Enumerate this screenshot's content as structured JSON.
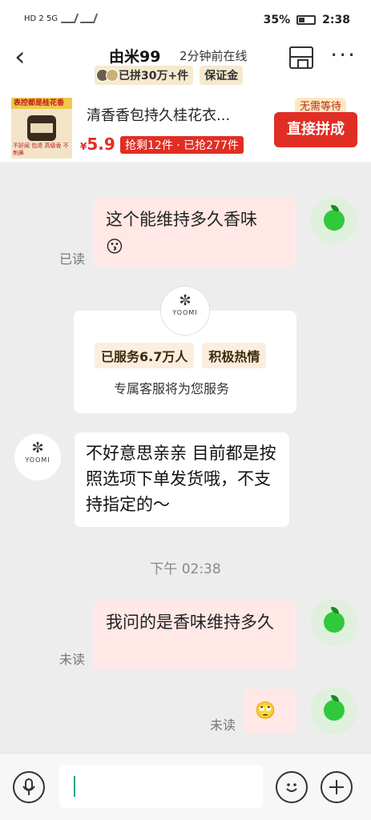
{
  "status_bar": {
    "network": "HD 2 5G",
    "battery": "35%",
    "time": "2:38"
  },
  "header": {
    "back_icon": "‹",
    "title": "由米99",
    "online": "2分钟前在线",
    "pin_tag": "已拼30万+件",
    "guarantee_tag": "保证金",
    "more_icon": "···"
  },
  "product": {
    "image_banner": "表控都是桂花香",
    "image_bottom_left": "不好闻 包退",
    "image_bottom_right": "高级香 不刺鼻",
    "title": "清香香包持久桂花衣...",
    "currency": "¥",
    "price": "5.9",
    "stock": "抢剩12件 · 已抢277件",
    "no_wait": "无需等待",
    "buy_button": "直接拼成"
  },
  "messages": [
    {
      "text": "这个能维持多久香味",
      "emoji": "😗",
      "status": "已读"
    },
    {
      "text": "我问的是香味维持多久",
      "status": "未读"
    },
    {
      "emoji": "🙄",
      "status": "未读"
    }
  ],
  "service_card": {
    "logo_mark": "✼",
    "logo_text": "YOOMI",
    "tags": [
      "已服务6.7万人",
      "积极热情"
    ],
    "description": "专属客服将为您服务"
  },
  "shop_reply": {
    "logo_mark": "✼",
    "logo_text": "YOOMI",
    "text": "不好意思亲亲 目前都是按照选项下单发货哦，不支持指定的～"
  },
  "timestamp": "下午 02:38",
  "input_bar": {
    "value": ""
  }
}
